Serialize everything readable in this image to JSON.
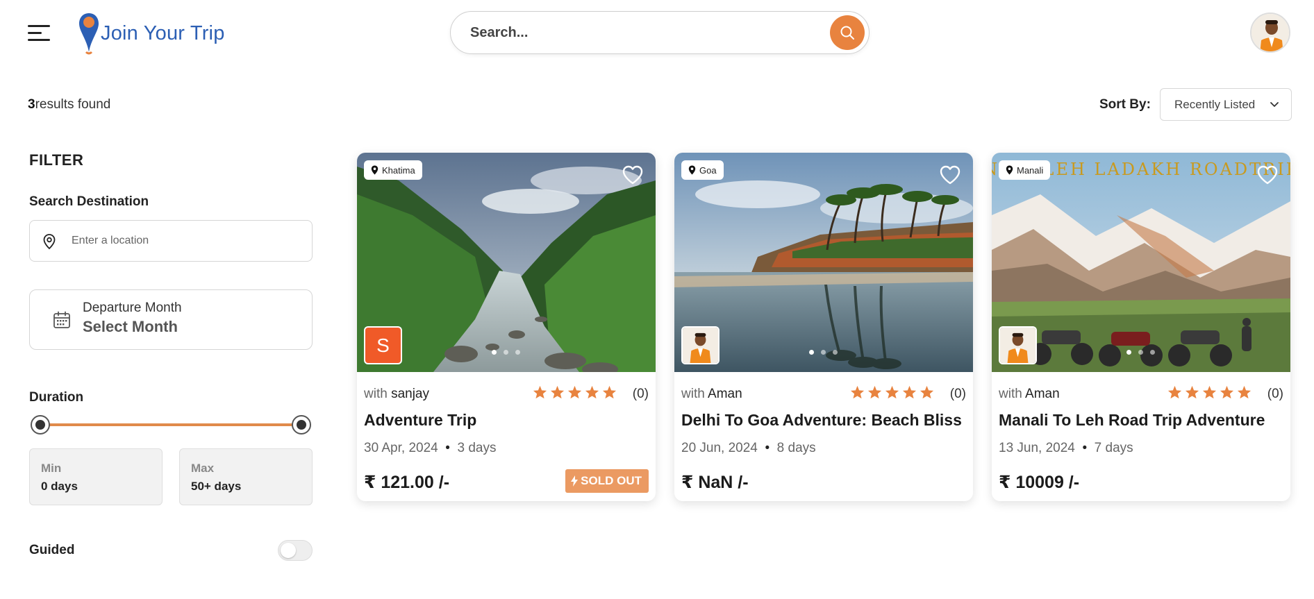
{
  "header": {
    "logo_text": "Join Your Trip",
    "search_placeholder": "Search..."
  },
  "results": {
    "count": "3",
    "suffix": "results found"
  },
  "sort": {
    "label": "Sort By:",
    "selected": "Recently Listed"
  },
  "filter": {
    "title": "FILTER",
    "search_destination_label": "Search Destination",
    "location_placeholder": "Enter a location",
    "departure_label": "Departure Month",
    "departure_value": "Select Month",
    "duration_label": "Duration",
    "duration_range": {
      "min_fraction": 0.0,
      "max_fraction": 1.0
    },
    "min_label": "Min",
    "min_value": "0 days",
    "max_label": "Max",
    "max_value": "50+ days",
    "guided_label": "Guided",
    "guided_on": false
  },
  "cards": [
    {
      "location": "Khatima",
      "host_prefix": "with",
      "host": "sanjay",
      "host_initial": "S",
      "rating_count": "(0)",
      "title": "Adventure Trip",
      "date": "30 Apr, 2024",
      "separator": "•",
      "duration": "3 days",
      "price": "₹ 121.00 /-",
      "badge": "SOLD OUT"
    },
    {
      "location": "Goa",
      "host_prefix": "with",
      "host": "Aman",
      "rating_count": "(0)",
      "title": "Delhi To Goa Adventure: Beach Bliss",
      "date": "20 Jun, 2024",
      "separator": "•",
      "duration": "8 days",
      "price": "₹ NaN /-"
    },
    {
      "location": "Manali",
      "image_caption": "NALI LEH LADAKH ROADTRIP",
      "host_prefix": "with",
      "host": "Aman",
      "rating_count": "(0)",
      "title": "Manali To Leh Road Trip Adventure",
      "date": "13 Jun, 2024",
      "separator": "•",
      "duration": "7 days",
      "price": "₹ 10009 /-"
    }
  ],
  "colors": {
    "accent": "#e8833f",
    "brand_blue": "#2c5fb4",
    "star": "#e8833f",
    "sold_out": "#eb9a62"
  }
}
